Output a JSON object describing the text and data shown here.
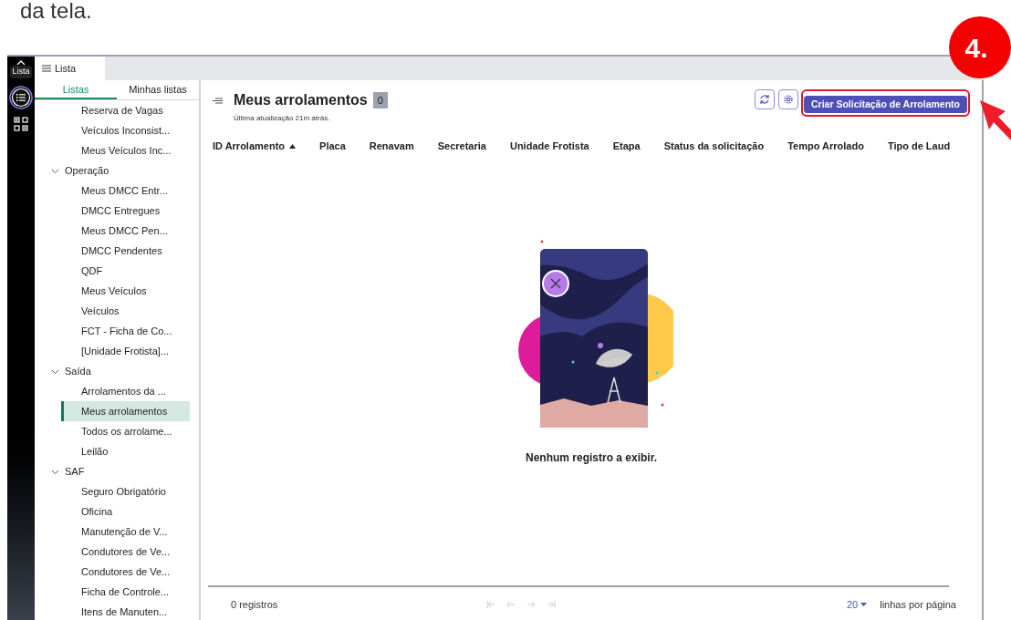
{
  "page_caption": "da tela.",
  "step_badge": "4.",
  "rail": {
    "label": "Lista"
  },
  "window_tab": {
    "label": "Lista",
    "selected": true
  },
  "sidebar": {
    "tabs": [
      {
        "label": "Listas",
        "selected": true
      },
      {
        "label": "Minhas listas",
        "selected": false
      }
    ],
    "items": [
      {
        "kind": "leaf",
        "label": "Reserva de Vagas",
        "selected": false
      },
      {
        "kind": "leaf",
        "label": "Veículos Inconsist...",
        "selected": false
      },
      {
        "kind": "leaf",
        "label": "Meus Veículos Inc...",
        "selected": false
      },
      {
        "kind": "group",
        "label": "Operação",
        "expanded": true,
        "children": [
          {
            "label": "Meus DMCC Entr...",
            "selected": false
          },
          {
            "label": "DMCC Entregues",
            "selected": false
          },
          {
            "label": "Meus DMCC Pen...",
            "selected": false
          },
          {
            "label": "DMCC Pendentes",
            "selected": false
          },
          {
            "label": "QDF",
            "selected": false
          },
          {
            "label": "Meus Veículos",
            "selected": false
          },
          {
            "label": "Veículos",
            "selected": false
          },
          {
            "label": "FCT - Ficha de Co...",
            "selected": false
          },
          {
            "label": "[Unidade Frotista]...",
            "selected": false
          }
        ]
      },
      {
        "kind": "group",
        "label": "Saída",
        "expanded": true,
        "children": [
          {
            "label": "Arrolamentos da ...",
            "selected": false
          },
          {
            "label": "Meus arrolamentos",
            "selected": true
          },
          {
            "label": "Todos os arrolame...",
            "selected": false
          },
          {
            "label": "Leilão",
            "selected": false
          }
        ]
      },
      {
        "kind": "group",
        "label": "SAF",
        "expanded": true,
        "children": [
          {
            "label": "Seguro Obrigatório",
            "selected": false
          },
          {
            "label": "Oficina",
            "selected": false
          },
          {
            "label": "Manutenção de V...",
            "selected": false
          },
          {
            "label": "Condutores de Ve...",
            "selected": false
          },
          {
            "label": "Condutores de Ve...",
            "selected": false
          },
          {
            "label": "Ficha de Controle...",
            "selected": false
          },
          {
            "label": "Itens de Manuten...",
            "selected": false
          }
        ]
      }
    ]
  },
  "header": {
    "title": "Meus arrolamentos",
    "count": "0",
    "updated": "Última atualização 21m atrás.",
    "create_button": "Criar Solicitação de Arrolamento"
  },
  "table": {
    "columns": [
      {
        "label": "ID Arrolamento",
        "sorted": true
      },
      {
        "label": "Placa"
      },
      {
        "label": "Renavam"
      },
      {
        "label": "Secretaria"
      },
      {
        "label": "Unidade Frotista"
      },
      {
        "label": "Etapa"
      },
      {
        "label": "Status da solicitação"
      },
      {
        "label": "Tempo Arrolado"
      },
      {
        "label": "Tipo de Laud"
      }
    ],
    "empty_message": "Nenhum registro a exibir."
  },
  "footer": {
    "records": "0 registros",
    "page_size": "20",
    "page_size_label": "linhas por página"
  }
}
